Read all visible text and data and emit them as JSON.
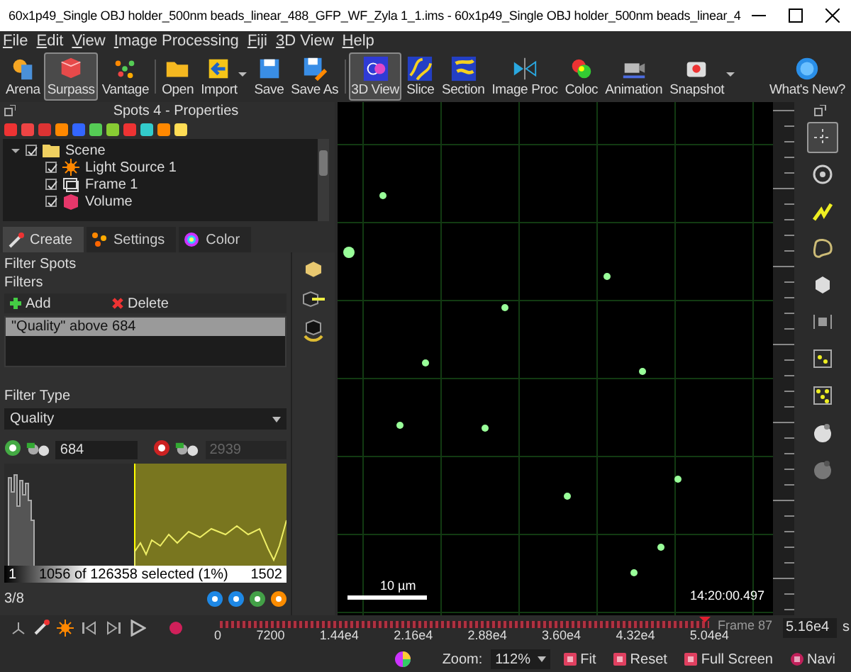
{
  "window": {
    "title": "60x1p49_Single OBJ holder_500nm beads_linear_488_GFP_WF_Zyla 1_1.ims - 60x1p49_Single OBJ holder_500nm beads_linear_4"
  },
  "menu": [
    "File",
    "Edit",
    "View",
    "Image Processing",
    "Fiji",
    "3D View",
    "Help"
  ],
  "toolbar": [
    {
      "label": "Arena",
      "selected": false,
      "kind": "plain"
    },
    {
      "label": "Surpass",
      "selected": true,
      "kind": "plain"
    },
    {
      "label": "Vantage",
      "selected": false,
      "kind": "plain"
    },
    {
      "label": "Open",
      "selected": false,
      "kind": "plain"
    },
    {
      "label": "Import",
      "selected": false,
      "kind": "split"
    },
    {
      "label": "Save",
      "selected": false,
      "kind": "plain"
    },
    {
      "label": "Save As",
      "selected": false,
      "kind": "plain"
    },
    {
      "label": "3D View",
      "selected": true,
      "kind": "plain"
    },
    {
      "label": "Slice",
      "selected": false,
      "kind": "plain"
    },
    {
      "label": "Section",
      "selected": false,
      "kind": "plain"
    },
    {
      "label": "Image Proc",
      "selected": false,
      "kind": "plain"
    },
    {
      "label": "Coloc",
      "selected": false,
      "kind": "plain"
    },
    {
      "label": "Animation",
      "selected": false,
      "kind": "plain"
    },
    {
      "label": "Snapshot",
      "selected": false,
      "kind": "split"
    },
    {
      "label": "What's New?",
      "selected": false,
      "kind": "plain"
    }
  ],
  "properties": {
    "title": "Spots 4 - Properties",
    "tree": [
      {
        "label": "Scene",
        "checked": true,
        "expanded": true,
        "children": [
          {
            "label": "Light Source 1",
            "checked": true
          },
          {
            "label": "Frame 1",
            "checked": true
          },
          {
            "label": "Volume",
            "checked": true
          }
        ]
      }
    ],
    "tabs": [
      {
        "label": "Create",
        "selected": true
      },
      {
        "label": "Settings",
        "selected": false
      },
      {
        "label": "Color",
        "selected": false
      }
    ],
    "section_title": "Filter Spots",
    "filters_label": "Filters",
    "filter_buttons": [
      "Add",
      "Delete"
    ],
    "filters": [
      {
        "label": "\"Quality\" above 684",
        "selected": true
      }
    ],
    "filter_type_label": "Filter Type",
    "filter_type": "Quality",
    "lower_threshold": {
      "value": "684",
      "enabled": true
    },
    "upper_threshold": {
      "value": "2939",
      "enabled": false
    },
    "range_min": "1",
    "selection_summary": "1056 of 126358 selected (1%)",
    "range_max": "1502",
    "page": "3/8"
  },
  "viewer": {
    "scale_bar": "10 µm",
    "timestamp": "14:20:00.497"
  },
  "right_tools": [
    {
      "selected": true
    },
    {
      "selected": false
    },
    {
      "selected": false
    },
    {
      "selected": false
    },
    {
      "selected": false
    },
    {
      "selected": false
    },
    {
      "selected": false
    },
    {
      "selected": false
    },
    {
      "selected": false
    },
    {
      "selected": false
    }
  ],
  "timeline": {
    "ticks": [
      "0",
      "7200",
      "1.44e4",
      "2.16e4",
      "2.88e4",
      "3.60e4",
      "4.32e4",
      "5.04e4"
    ],
    "level": 0.99,
    "frame_label": "Frame 87",
    "time_value": "5.16e4",
    "unit": "s"
  },
  "status_bar": {
    "zoom_label": "Zoom:",
    "zoom_value": "112%",
    "buttons": [
      "Fit",
      "Reset",
      "Full Screen",
      "Navi"
    ]
  }
}
